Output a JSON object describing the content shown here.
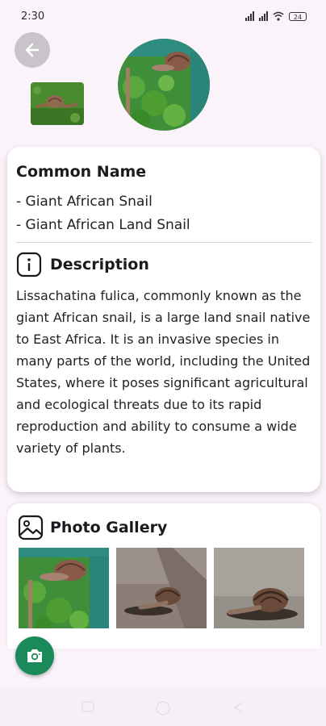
{
  "status_bar": {
    "time": "2:30",
    "battery": "24"
  },
  "common_name": {
    "title": "Common Name",
    "names": [
      "- Giant African Snail",
      "- Giant African Land Snail"
    ]
  },
  "description": {
    "title": "Description",
    "text": "Lissachatina fulica, commonly known as the giant African snail, is a large land snail native to East Africa. It is an invasive species in many parts of the world, including the United States, where it poses significant agricultural and ecological threats due to its rapid reproduction and ability to consume a wide variety of plants."
  },
  "gallery": {
    "title": "Photo Gallery"
  },
  "icons": {
    "back": "arrow-left-icon",
    "info": "info-icon",
    "image": "image-icon",
    "camera": "camera-icon"
  },
  "colors": {
    "accent": "#1a8a5a",
    "background": "#fbf3fa"
  }
}
